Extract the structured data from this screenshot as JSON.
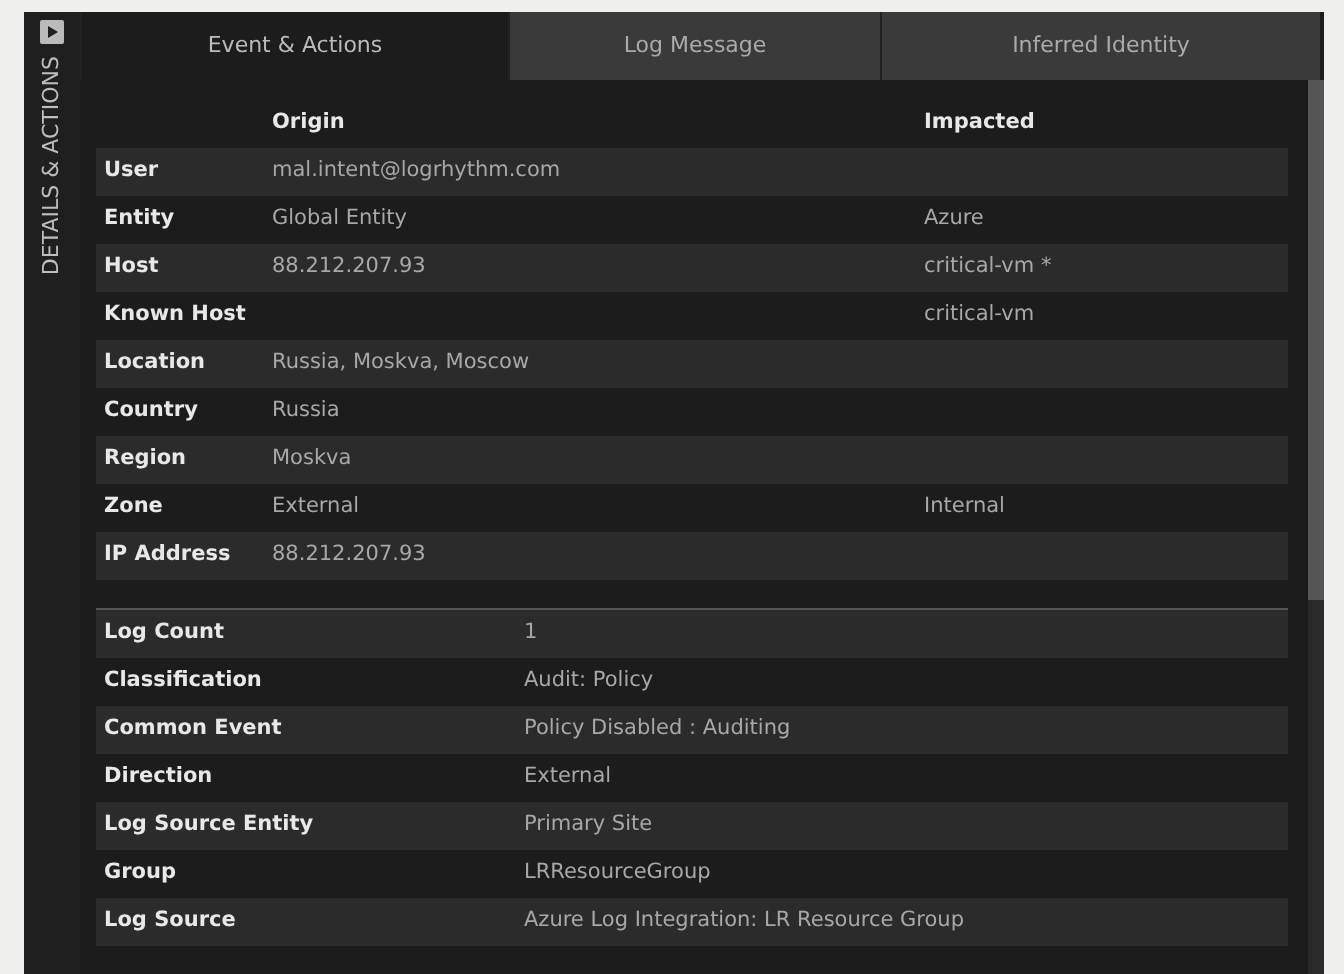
{
  "side_tab": {
    "label": "DETAILS & ACTIONS"
  },
  "tabs": [
    {
      "label": "Event & Actions",
      "selected": true
    },
    {
      "label": "Log Message",
      "selected": false
    },
    {
      "label": "Inferred Identity",
      "selected": false
    }
  ],
  "origin_table": {
    "columns": [
      "Origin",
      "Impacted"
    ],
    "rows": [
      {
        "label": "User",
        "origin": "mal.intent@logrhythm.com"
      },
      {
        "label": "Entity",
        "origin": "Global Entity",
        "impacted": "Azure"
      },
      {
        "label": "Host",
        "origin": "88.212.207.93",
        "impacted": "critical-vm *"
      },
      {
        "label": "Known Host",
        "impacted": "critical-vm"
      },
      {
        "label": "Location",
        "origin": "Russia, Moskva, Moscow"
      },
      {
        "label": "Country",
        "origin": "Russia"
      },
      {
        "label": "Region",
        "origin": "Moskva"
      },
      {
        "label": "Zone",
        "origin": "External",
        "impacted": "Internal"
      },
      {
        "label": "IP Address",
        "origin": "88.212.207.93"
      }
    ]
  },
  "details_table": {
    "rows": [
      {
        "label": "Log Count",
        "value": "1"
      },
      {
        "label": "Classification",
        "value": "Audit: Policy"
      },
      {
        "label": "Common Event",
        "value": "Policy Disabled : Auditing"
      },
      {
        "label": "Direction",
        "value": "External"
      },
      {
        "label": "Log Source Entity",
        "value": "Primary Site"
      },
      {
        "label": "Group",
        "value": "LRResourceGroup"
      },
      {
        "label": "Log Source",
        "value": "Azure Log Integration: LR Resource Group"
      }
    ]
  }
}
